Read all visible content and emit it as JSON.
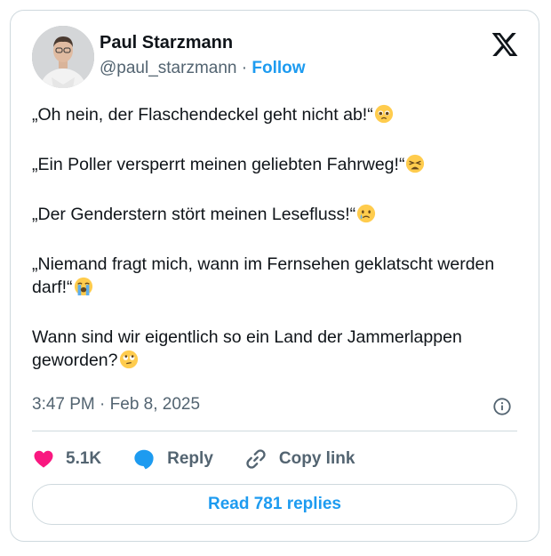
{
  "author": {
    "name": "Paul Starzmann",
    "handle": "@paul_starzmann",
    "separator": "·",
    "follow_label": "Follow"
  },
  "tweet": {
    "lines": [
      {
        "text": "„Oh nein, der Flaschendeckel geht nicht ab!“",
        "emoji": "pleading-face"
      },
      {
        "text": "„Ein Poller versperrt meinen geliebten Fahrweg!“",
        "emoji": "weary-face"
      },
      {
        "text": "„Der Genderstern stört meinen Lesefluss!“",
        "emoji": "crying-face"
      },
      {
        "text": "„Niemand fragt mich, wann im Fernsehen geklatscht werden darf!“",
        "emoji": "loudly-crying-face"
      },
      {
        "text": "Wann sind wir eigentlich so ein Land der Jammerlappen geworden?",
        "emoji": "eye-roll-face"
      }
    ]
  },
  "meta": {
    "time": "3:47 PM · Feb 8, 2025"
  },
  "actions": {
    "likes": "5.1K",
    "reply_label": "Reply",
    "copy_label": "Copy link"
  },
  "read_replies_label": "Read 781 replies",
  "colors": {
    "accent": "#1d9bf0",
    "like": "#f91880",
    "text": "#0f1419",
    "muted": "#536471",
    "border": "#cfd9de"
  }
}
